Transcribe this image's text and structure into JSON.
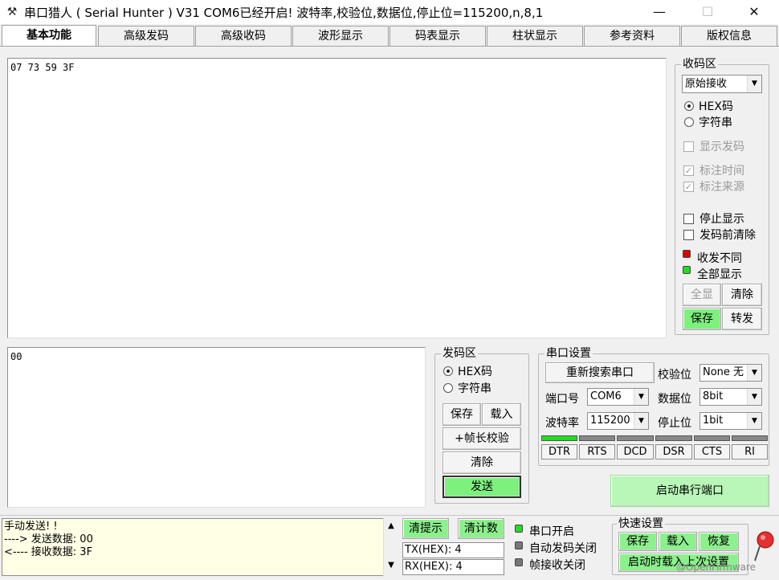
{
  "window": {
    "title": "串口猎人 ( Serial Hunter ) V31    COM6已经开启!  波特率,校验位,数据位,停止位=115200,n,8,1",
    "minimize": "—",
    "maximize": "☐",
    "close": "✕"
  },
  "tabs": [
    "基本功能",
    "高级发码",
    "高级收码",
    "波形显示",
    "码表显示",
    "柱状显示",
    "参考资料",
    "版权信息"
  ],
  "receive_area": {
    "content": "07 73 59 3F"
  },
  "send_area": {
    "content": "00"
  },
  "recv_panel": {
    "title": "收码区",
    "mode_select": "原始接收",
    "radio_hex": "HEX码",
    "radio_str": "字符串",
    "show_send": "显示发码",
    "mark_time": "标注时间",
    "mark_source": "标注来源",
    "stop_display": "停止显示",
    "clear_before_send": "发码前清除",
    "led_diff": "收发不同",
    "led_all": "全部显示",
    "btn_all": "全显",
    "btn_clear": "清除",
    "btn_save": "保存",
    "btn_forward": "转发"
  },
  "send_panel": {
    "title": "发码区",
    "radio_hex": "HEX码",
    "radio_str": "字符串",
    "btn_save": "保存",
    "btn_load": "载入",
    "btn_frame": "+帧长校验",
    "btn_clear": "清除",
    "btn_send": "发送"
  },
  "port_panel": {
    "title": "串口设置",
    "btn_rescan": "重新搜索串口",
    "port_label": "端口号",
    "port_value": "COM6",
    "baud_label": "波特率",
    "baud_value": "115200",
    "parity_label": "校验位",
    "parity_value": "None 无",
    "data_label": "数据位",
    "data_value": "8bit",
    "stop_label": "停止位",
    "stop_value": "1bit",
    "signals": [
      "DTR",
      "RTS",
      "DCD",
      "DSR",
      "CTS",
      "RI"
    ],
    "signal_colors": [
      "#22dd22",
      "#888888",
      "#888888",
      "#888888",
      "#888888",
      "#888888"
    ],
    "btn_start": "启动串行端口"
  },
  "bottom": {
    "log_lines": [
      "手动发送! !",
      "----> 发送数据: 00",
      "<---- 接收数据: 3F"
    ],
    "btn_hint": "清提示",
    "btn_count": "清计数",
    "tx_value": "TX(HEX): 4",
    "rx_value": "RX(HEX): 4",
    "status_port_open": "串口开启",
    "status_auto_send": "自动发码关闭",
    "status_frame_recv": "帧接收关闭",
    "quick_title": "快速设置",
    "quick_save": "保存",
    "quick_load": "载入",
    "quick_restore": "恢复",
    "quick_startup": "启动时载入上次设置",
    "watermark": "@OpenFirmware"
  }
}
